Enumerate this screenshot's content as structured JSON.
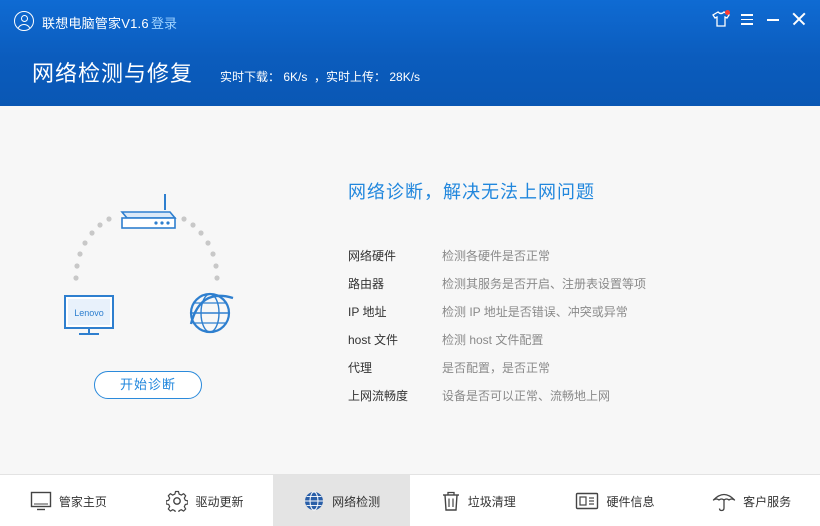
{
  "app": {
    "title": "联想电脑管家V1.6",
    "login": "登录"
  },
  "window_controls": [
    {
      "name": "skin-icon"
    },
    {
      "name": "menu-icon"
    },
    {
      "name": "minimize-icon"
    },
    {
      "name": "close-icon"
    }
  ],
  "header": {
    "title": "网络检测与修复",
    "speed_text": "实时下载： 6K/s  ，实时上传： 28K/s"
  },
  "main": {
    "headline": "网络诊断，解决无法上网问题",
    "monitor_brand": "Lenovo",
    "start_button": "开始诊断",
    "checks": [
      {
        "name": "网络硬件",
        "desc": "检测各硬件是否正常"
      },
      {
        "name": "路由器",
        "desc": "检测其服务是否开启、注册表设置等项"
      },
      {
        "name": "IP 地址",
        "desc": "检测 IP 地址是否错误、冲突或异常"
      },
      {
        "name": "host 文件",
        "desc": "检测 host 文件配置"
      },
      {
        "name": "代理",
        "desc": "是否配置，是否正常"
      },
      {
        "name": "上网流畅度",
        "desc": "设备是否可以正常、流畅地上网"
      }
    ]
  },
  "nav": [
    {
      "label": "管家主页",
      "icon": "monitor-icon"
    },
    {
      "label": "驱动更新",
      "icon": "gear-icon"
    },
    {
      "label": "网络检测",
      "icon": "globe-icon",
      "active": true
    },
    {
      "label": "垃圾清理",
      "icon": "trash-icon"
    },
    {
      "label": "硬件信息",
      "icon": "hardware-icon"
    },
    {
      "label": "客户服务",
      "icon": "umbrella-icon"
    }
  ],
  "colors": {
    "header_blue": "#0b5cbd",
    "accent": "#2187dd"
  }
}
